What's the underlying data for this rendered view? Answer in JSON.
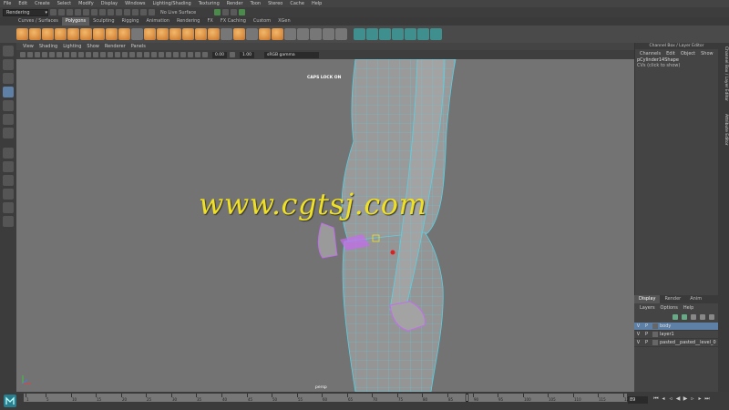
{
  "menubar": {
    "items": [
      "File",
      "Edit",
      "Create",
      "Select",
      "Modify",
      "Display",
      "Windows",
      "Lighting/Shading",
      "Texturing",
      "Render",
      "Toon",
      "Stereo",
      "Cache",
      "Help"
    ]
  },
  "statusline": {
    "mode": "Rendering",
    "live_surface": "No Live Surface"
  },
  "shelf": {
    "tabs": [
      "Curves / Surfaces",
      "Polygons",
      "Sculpting",
      "Rigging",
      "Animation",
      "Rendering",
      "FX",
      "FX Caching",
      "Custom",
      "XGen"
    ],
    "active_tab": "Polygons"
  },
  "viewport": {
    "menu": [
      "View",
      "Shading",
      "Lighting",
      "Show",
      "Renderer",
      "Panels"
    ],
    "value_a": "0.00",
    "value_b": "1.00",
    "color_space": "sRGB gamma",
    "caps_lock": "CAPS LOCK ON",
    "camera": "persp",
    "watermark": "www.cgtsj.com"
  },
  "channel_box": {
    "title": "Channel Box / Layer Editor",
    "menu": [
      "Channels",
      "Edit",
      "Object",
      "Show"
    ],
    "object_name": "pCylinder14Shape",
    "object_sub": "CVs (click to show)"
  },
  "layer_editor": {
    "tabs": [
      "Display",
      "Render",
      "Anim"
    ],
    "menu": [
      "Layers",
      "Options",
      "Help"
    ],
    "layers": [
      {
        "v": "V",
        "p": "P",
        "name": "body",
        "selected": true
      },
      {
        "v": "V",
        "p": "P",
        "name": "layer1",
        "selected": false
      },
      {
        "v": "V",
        "p": "P",
        "name": "pasted__pasted__level_0",
        "selected": false
      }
    ]
  },
  "side_tabs": [
    "Channel Box / Layer Editor",
    "Attribute Editor"
  ],
  "timeline": {
    "current_frame": "89",
    "frame_field": "89",
    "ticks": [
      "1",
      "5",
      "10",
      "15",
      "20",
      "25",
      "30",
      "35",
      "40",
      "45",
      "50",
      "55",
      "60",
      "65",
      "70",
      "75",
      "80",
      "85",
      "90",
      "95",
      "100",
      "105",
      "110",
      "115",
      "120"
    ]
  },
  "colors": {
    "viewport_bg": "#737373",
    "wire": "#58d2e6",
    "selection": "#c46cf0",
    "watermark": "#f0e024",
    "layer_selected": "#5e7fa6"
  }
}
